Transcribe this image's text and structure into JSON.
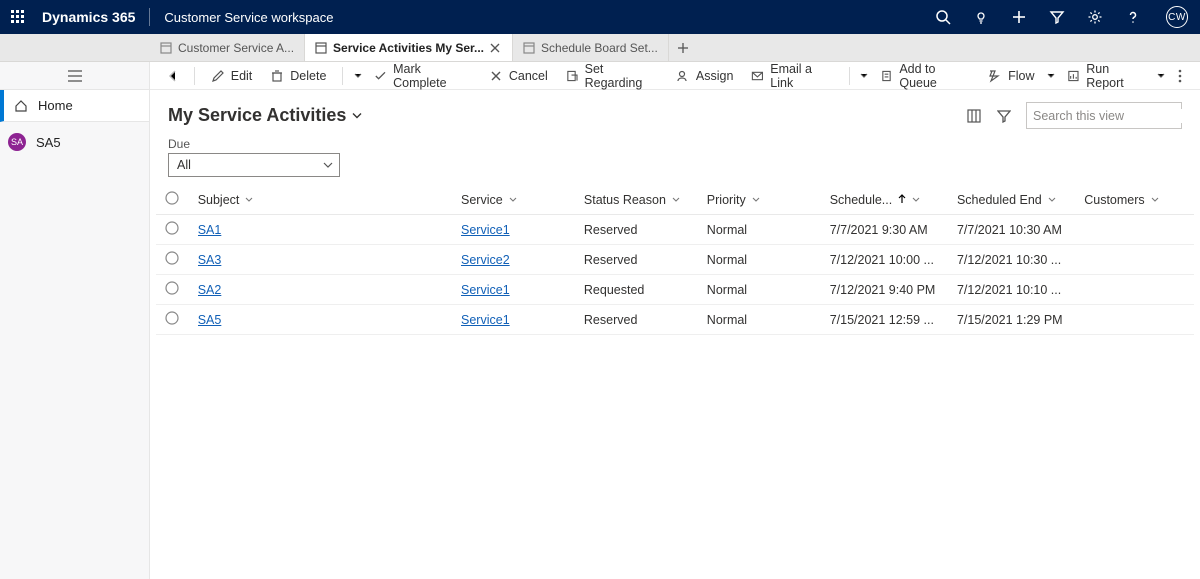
{
  "topbar": {
    "brand": "Dynamics 365",
    "appName": "Customer Service workspace",
    "avatarInitials": "CW"
  },
  "tabs": {
    "items": [
      {
        "label": "Customer Service A..."
      },
      {
        "label": "Service Activities My Ser..."
      },
      {
        "label": "Schedule Board Set..."
      }
    ],
    "activeIndex": 1
  },
  "left_rail": {
    "home": "Home",
    "session": "SA5"
  },
  "cmdbar": {
    "edit": "Edit",
    "delete": "Delete",
    "markComplete": "Mark Complete",
    "cancel": "Cancel",
    "setRegarding": "Set Regarding",
    "assign": "Assign",
    "emailLink": "Email a Link",
    "addToQueue": "Add to Queue",
    "flow": "Flow",
    "runReport": "Run Report"
  },
  "view": {
    "title": "My Service Activities",
    "search_placeholder": "Search this view"
  },
  "filter": {
    "label": "Due",
    "value": "All"
  },
  "grid": {
    "columns": {
      "subject": "Subject",
      "service": "Service",
      "statusReason": "Status Reason",
      "priority": "Priority",
      "scheduledStart": "Schedule...",
      "scheduledEnd": "Scheduled End",
      "customers": "Customers"
    },
    "rows": [
      {
        "subject": "SA1",
        "service": "Service1",
        "statusReason": "Reserved",
        "priority": "Normal",
        "start": "7/7/2021 9:30 AM",
        "end": "7/7/2021 10:30 AM",
        "customers": ""
      },
      {
        "subject": "SA3",
        "service": "Service2",
        "statusReason": "Reserved",
        "priority": "Normal",
        "start": "7/12/2021 10:00 ...",
        "end": "7/12/2021 10:30 ...",
        "customers": ""
      },
      {
        "subject": "SA2",
        "service": "Service1",
        "statusReason": "Requested",
        "priority": "Normal",
        "start": "7/12/2021 9:40 PM",
        "end": "7/12/2021 10:10 ...",
        "customers": ""
      },
      {
        "subject": "SA5",
        "service": "Service1",
        "statusReason": "Reserved",
        "priority": "Normal",
        "start": "7/15/2021 12:59 ...",
        "end": "7/15/2021 1:29 PM",
        "customers": ""
      }
    ]
  }
}
